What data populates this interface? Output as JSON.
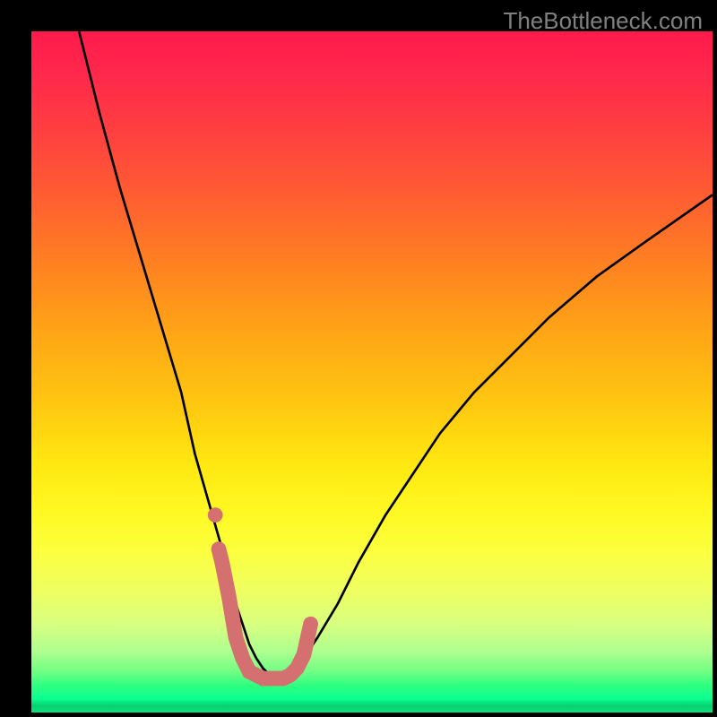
{
  "watermark": "TheBottleneck.com",
  "chart_data": {
    "type": "line",
    "title": "",
    "xlabel": "",
    "ylabel": "",
    "xlim": [
      0,
      100
    ],
    "ylim": [
      0,
      100
    ],
    "series": [
      {
        "name": "bottleneck-curve",
        "color": "#000000",
        "x": [
          7,
          10,
          13,
          16,
          19,
          22,
          24,
          26,
          28,
          29,
          30,
          31,
          32,
          33,
          34,
          35,
          36,
          37,
          38,
          39,
          40,
          42,
          45,
          48,
          52,
          56,
          60,
          65,
          70,
          76,
          83,
          90,
          100
        ],
        "y": [
          100,
          88,
          77,
          67,
          57,
          47,
          38,
          31,
          24,
          20,
          16,
          13,
          10,
          8,
          6.5,
          5.5,
          5,
          5,
          5.5,
          6.5,
          8,
          11,
          16,
          22,
          29,
          35,
          41,
          47,
          52,
          58,
          64,
          69,
          76
        ]
      },
      {
        "name": "highlight-band",
        "color": "#d47070",
        "thick": true,
        "x": [
          27.5,
          28,
          29,
          30,
          31,
          32,
          33,
          34,
          35,
          36,
          37,
          38,
          39,
          40,
          41
        ],
        "y": [
          24,
          22,
          17,
          11,
          8,
          6,
          5.5,
          5,
          5,
          5,
          5,
          5.5,
          6.5,
          8.5,
          13
        ]
      },
      {
        "name": "highlight-dot",
        "color": "#d47070",
        "point": true,
        "x": [
          27
        ],
        "y": [
          29
        ]
      }
    ],
    "background_gradient": {
      "type": "vertical",
      "stops": [
        {
          "pos": 0.0,
          "color": "#ff1a4d"
        },
        {
          "pos": 0.15,
          "color": "#ff4040"
        },
        {
          "pos": 0.35,
          "color": "#ff8420"
        },
        {
          "pos": 0.55,
          "color": "#ffc810"
        },
        {
          "pos": 0.7,
          "color": "#fff820"
        },
        {
          "pos": 0.85,
          "color": "#d8ff80"
        },
        {
          "pos": 0.95,
          "color": "#30ff80"
        },
        {
          "pos": 1.0,
          "color": "#10e080"
        }
      ]
    }
  }
}
